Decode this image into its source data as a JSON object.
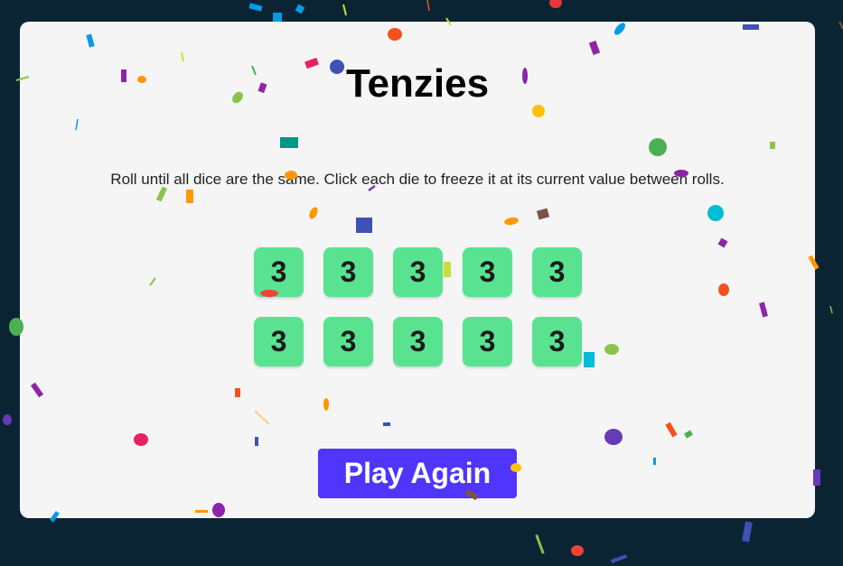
{
  "game": {
    "title": "Tenzies",
    "instructions": "Roll until all dice are the same. Click each die to freeze it at its current value between rolls.",
    "dice": [
      "3",
      "3",
      "3",
      "3",
      "3",
      "3",
      "3",
      "3",
      "3",
      "3"
    ],
    "play_again_label": "Play Again"
  },
  "colors": {
    "background": "#0b2434",
    "card": "#f5f5f5",
    "die_held": "#59e391",
    "button": "#5035ff"
  }
}
